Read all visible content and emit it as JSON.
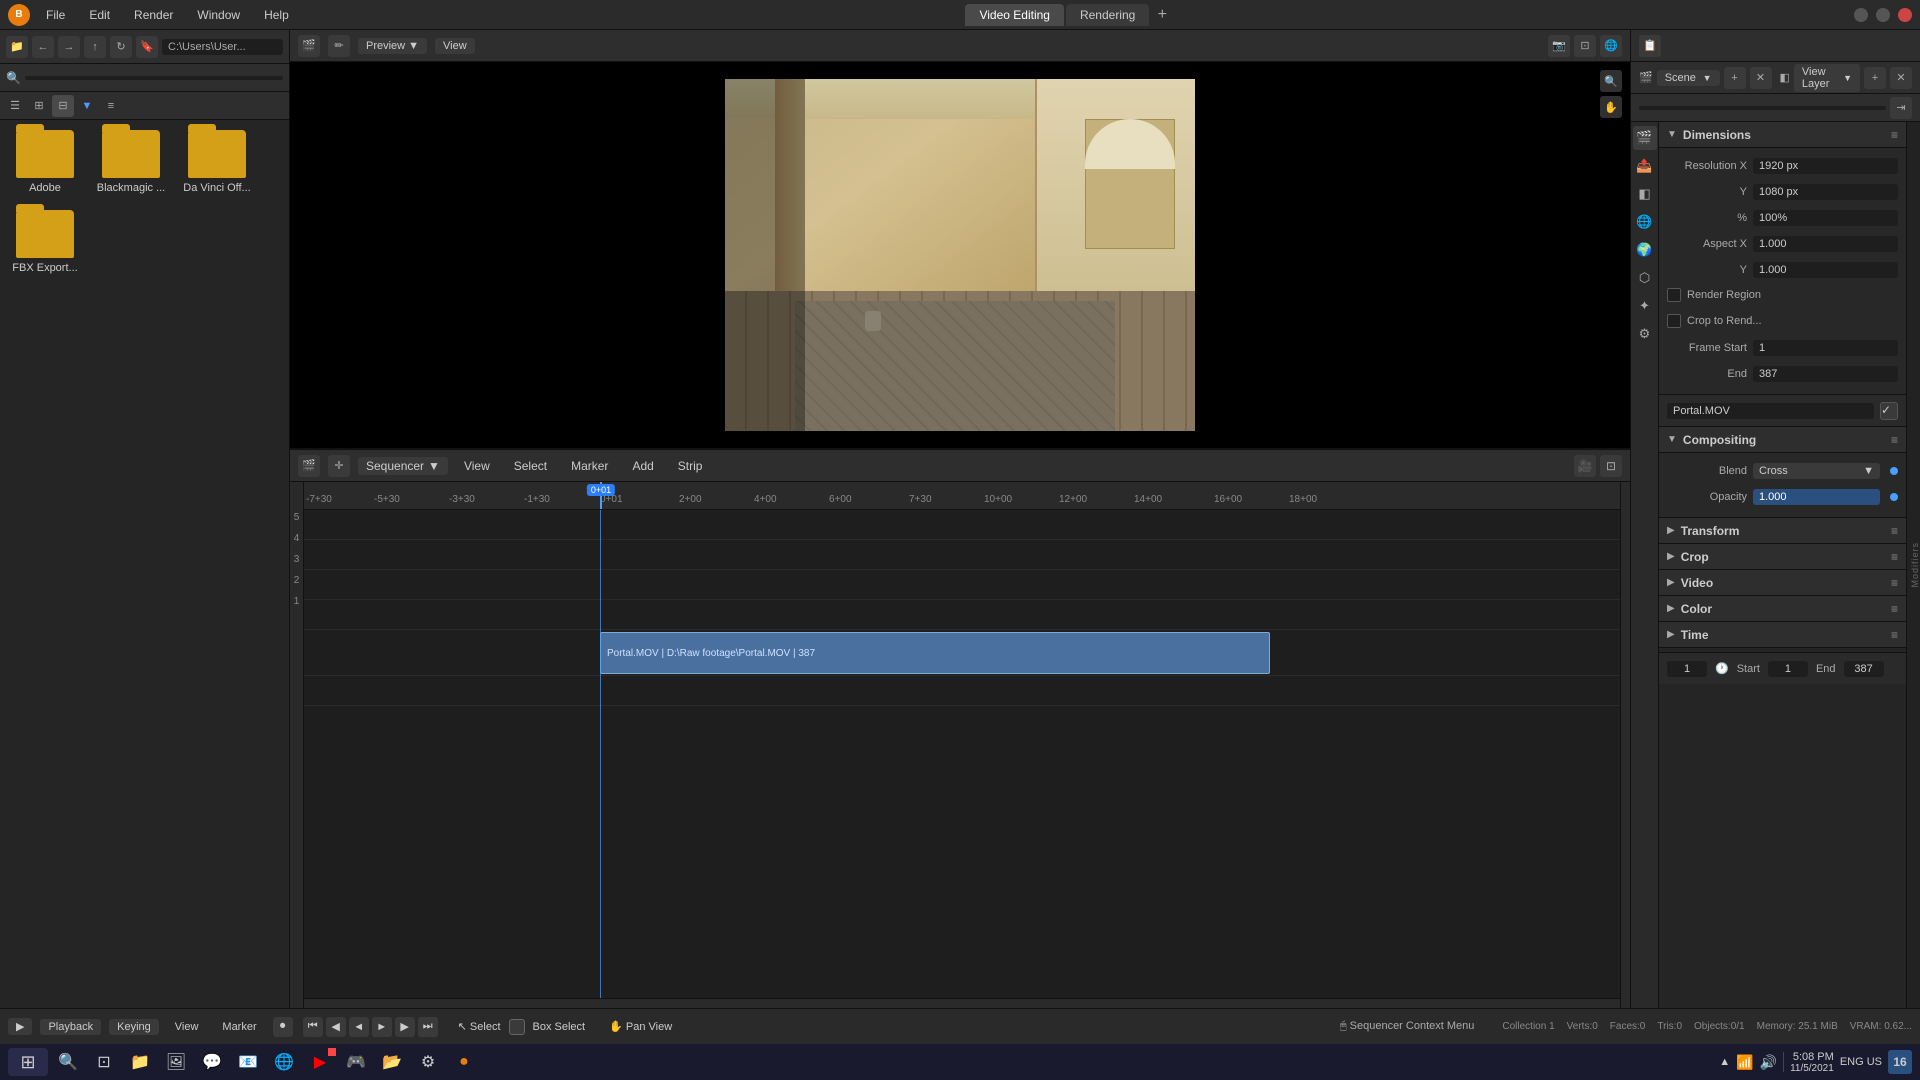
{
  "app": {
    "title": "Blender",
    "logo": "B"
  },
  "titlebar": {
    "menus": [
      "File",
      "Edit",
      "Render",
      "Window",
      "Help"
    ],
    "workspaces": [
      "Video Editing",
      "Rendering"
    ],
    "active_workspace": "Video Editing"
  },
  "file_browser": {
    "path": "C:\\Users\\User...",
    "search_placeholder": "Search",
    "folders": [
      {
        "name": "Adobe"
      },
      {
        "name": "Blackmagic ..."
      },
      {
        "name": "Da Vinci Off...",
        "row": 2
      },
      {
        "name": "FBX Export...",
        "row": 2
      }
    ]
  },
  "preview": {
    "view_mode": "Preview",
    "view_label": "View"
  },
  "sequencer": {
    "workspace": "Sequencer",
    "menus": [
      "View",
      "Select",
      "Marker",
      "Add",
      "Strip"
    ],
    "ruler_marks": [
      "-7+30",
      "-5+30",
      "-3+30",
      "-1+30",
      "0+01",
      "2+00",
      "4+00",
      "6+00",
      "7+30",
      "10+00",
      "12+00",
      "14+00",
      "16+00",
      "18+00"
    ],
    "active_frame": "0+01",
    "clip": {
      "name": "Portal.MOV | D:\\Raw footage\\Portal.MOV | 387",
      "short_name": "Portal.MOV"
    }
  },
  "properties": {
    "scene_label": "Scene",
    "view_layer_label": "View Layer",
    "search_placeholder": "",
    "strip_name": "Portal.MOV",
    "dimensions": {
      "title": "Dimensions",
      "resolution_x_label": "Resolution X",
      "resolution_x": "1920 px",
      "resolution_y_label": "Y",
      "resolution_y": "1080 px",
      "percent_label": "%",
      "percent": "100%",
      "aspect_x_label": "Aspect X",
      "aspect_x": "1.000",
      "aspect_y_label": "Y",
      "aspect_y": "1.000",
      "render_region_label": "Render Region",
      "crop_render_label": "Crop to Rend...",
      "frame_start_label": "Frame Start",
      "frame_start": "1",
      "frame_end_label": "End",
      "frame_end": "387"
    },
    "compositing": {
      "title": "Compositing",
      "blend_label": "Blend",
      "blend_value": "Cross",
      "opacity_label": "Opacity",
      "opacity_value": "1.000"
    },
    "sections": [
      "Transform",
      "Crop",
      "Video",
      "Color",
      "Time"
    ],
    "bottom": {
      "frame": "1",
      "start_label": "Start",
      "start": "1",
      "end_label": "End",
      "end": "387"
    }
  },
  "playback_bar": {
    "workspace_label": "▶",
    "playback_label": "Playback",
    "keying_label": "Keying",
    "view_label": "View",
    "marker_label": "Marker",
    "context_menu": "Sequencer Context Menu",
    "select_label": "Select",
    "box_select_label": "Box Select",
    "pan_view_label": "Pan View"
  },
  "status_bar": {
    "collection": "Collection 1",
    "verts": "Verts:0",
    "faces": "Faces:0",
    "tris": "Tris:0",
    "objects": "Objects:0/1",
    "memory": "Memory: 25.1 MiB",
    "vram": "VRAM: 0.62..."
  },
  "taskbar": {
    "time": "5:08 PM",
    "date": "11/5/2021",
    "lang": "ENG US"
  }
}
